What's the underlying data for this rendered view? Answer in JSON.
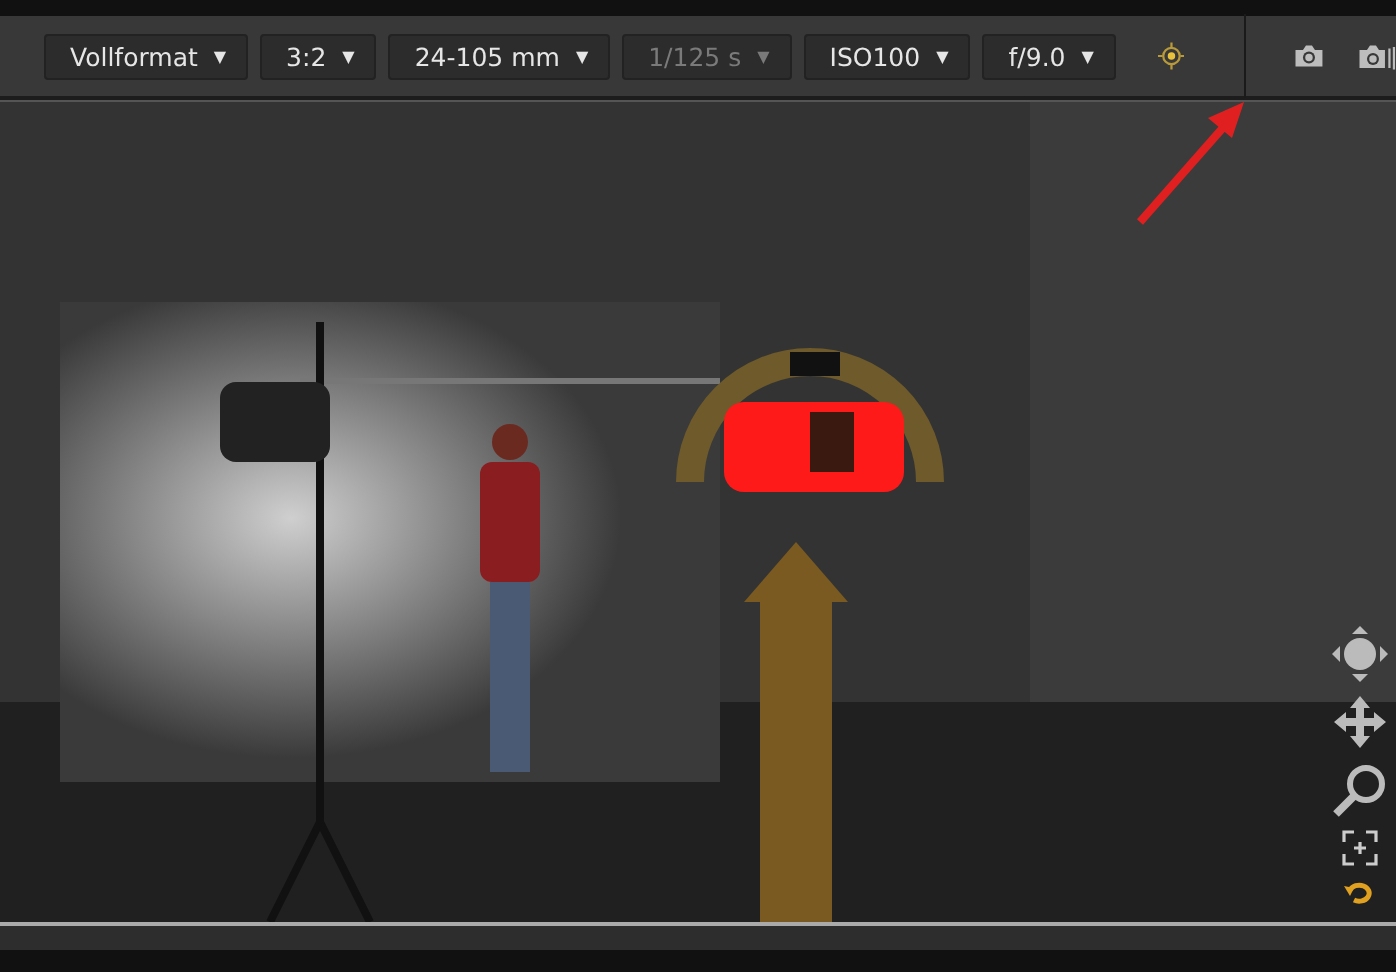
{
  "toolbar": {
    "dropdowns": [
      {
        "label": "Vollformat",
        "caret": "▼",
        "disabled": false
      },
      {
        "label": "3:2",
        "caret": "▼",
        "disabled": false
      },
      {
        "label": "24-105 mm",
        "caret": "▼",
        "disabled": false
      },
      {
        "label": "1/125 s",
        "caret": "▼",
        "disabled": true
      },
      {
        "label": "ISO100",
        "caret": "▼",
        "disabled": false
      },
      {
        "label": "f/9.0",
        "caret": "▼",
        "disabled": false
      }
    ]
  }
}
